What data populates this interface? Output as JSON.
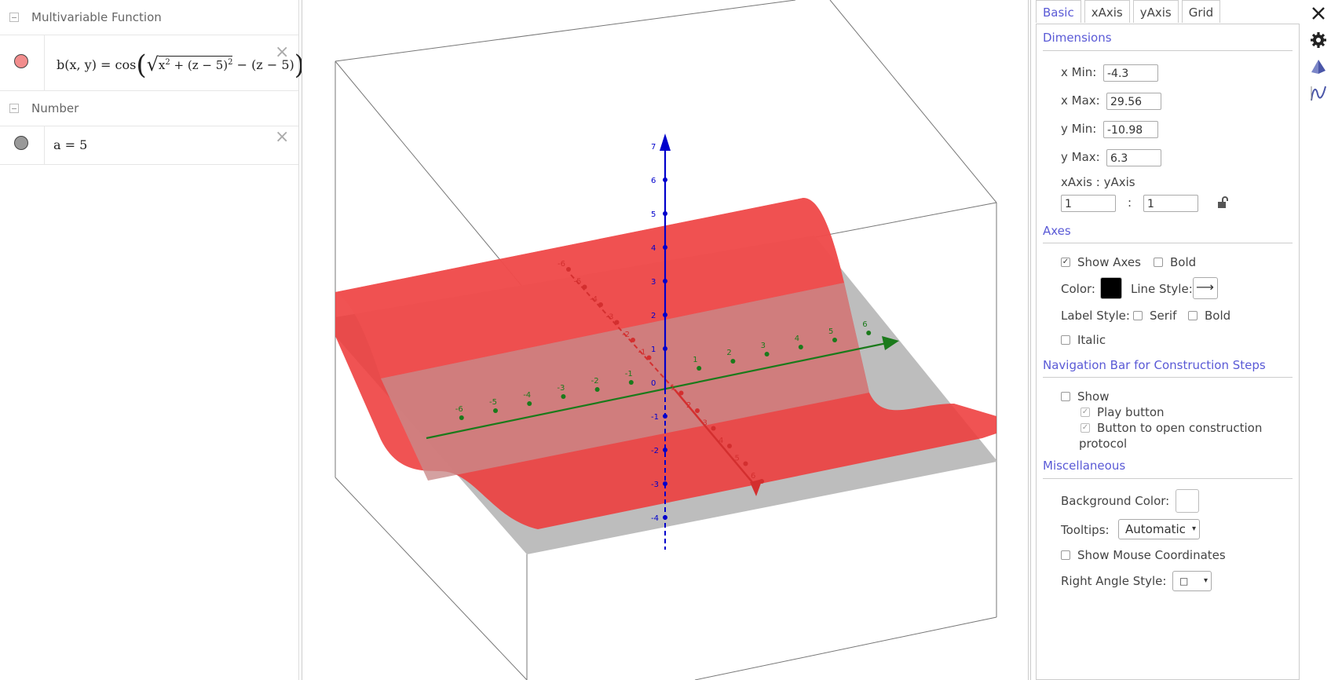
{
  "algebra": {
    "categories": [
      {
        "title": "Multivariable Function"
      },
      {
        "title": "Number"
      }
    ],
    "items": [
      {
        "marble_color": "#f28d8d",
        "formula_left": "b(x, y)  =  cos",
        "formula_rad_a": "x",
        "formula_rad_sup": "2",
        "formula_rad_b": " + (z − 5)",
        "formula_rad_sup2": "2",
        "formula_after": " − (z − 5)"
      },
      {
        "marble_color": "#999999",
        "formula": "a  =  5"
      }
    ],
    "close_glyph": "×"
  },
  "graphics": {
    "axis_colors": {
      "x": "#d32f2f",
      "y": "#1b7a1b",
      "z": "#0000cc"
    },
    "surface_color": "#ee3b3b",
    "shadow_color": "#bdbdbd",
    "x_ticks": [
      "-6",
      "-5",
      "-4",
      "-3",
      "-2",
      "-1",
      "1",
      "2",
      "3",
      "4",
      "5",
      "6"
    ],
    "y_ticks": [
      "-6",
      "-5",
      "-4",
      "-3",
      "-2",
      "-1",
      "1",
      "2",
      "3",
      "4",
      "5",
      "6"
    ],
    "z_ticks": [
      "7",
      "6",
      "5",
      "4",
      "3",
      "2",
      "1",
      "0",
      "-1",
      "-2",
      "-3",
      "-4"
    ]
  },
  "settings": {
    "tabs": [
      "Basic",
      "xAxis",
      "yAxis",
      "Grid"
    ],
    "dimensions": {
      "title": "Dimensions",
      "xmin_label": "x Min:",
      "xmin": "-4.3",
      "xmax_label": "x Max:",
      "xmax": "29.56",
      "ymin_label": "y Min:",
      "ymin": "-10.98",
      "ymax_label": "y Max:",
      "ymax": "6.3",
      "ratio_label": "xAxis : yAxis",
      "ratio_x": "1",
      "ratio_sep": ":",
      "ratio_y": "1"
    },
    "axes": {
      "title": "Axes",
      "show_axes": "Show Axes",
      "bold": "Bold",
      "color_label": "Color:",
      "axis_color": "#000000",
      "line_style_label": "Line Style:",
      "line_style": "⟶",
      "label_style_label": "Label Style:",
      "serif": "Serif",
      "label_bold": "Bold",
      "italic": "Italic"
    },
    "navbar": {
      "title": "Navigation Bar for Construction Steps",
      "show": "Show",
      "play_button": "Play button",
      "open_protocol_1": "Button to open construction",
      "open_protocol_2": "protocol"
    },
    "misc": {
      "title": "Miscellaneous",
      "bg_color_label": "Background Color:",
      "bg_color": "#ffffff",
      "tooltips_label": "Tooltips:",
      "tooltips_value": "Automatic",
      "mouse_coords": "Show Mouse Coordinates",
      "right_angle_label": "Right Angle Style:",
      "right_angle_value": "□"
    },
    "check": "✓",
    "arrow": "▾"
  }
}
